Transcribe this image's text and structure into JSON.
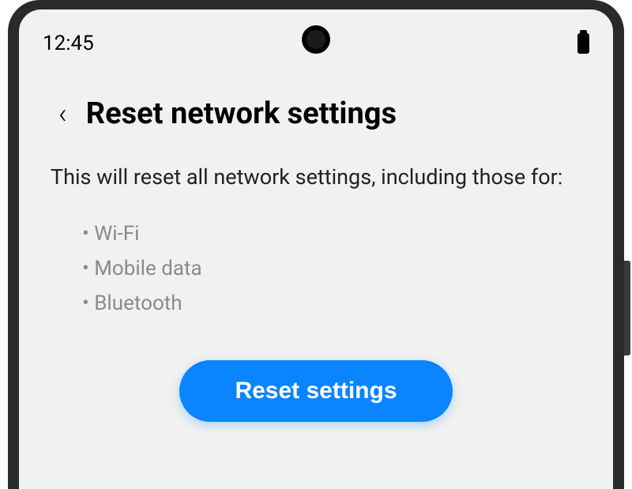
{
  "status_bar": {
    "time": "12:45"
  },
  "header": {
    "title": "Reset network settings"
  },
  "content": {
    "description": "This will reset all network settings, including those for:",
    "items": [
      "Wi-Fi",
      "Mobile data",
      "Bluetooth"
    ]
  },
  "button": {
    "label": "Reset settings"
  }
}
